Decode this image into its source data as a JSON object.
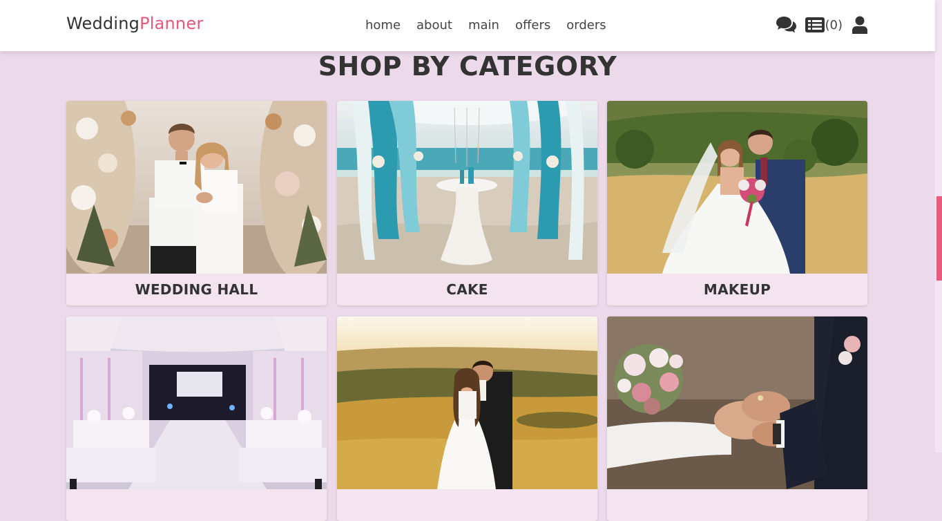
{
  "header": {
    "logo_main": "Wedding",
    "logo_accent": "Planner",
    "nav": [
      "home",
      "about",
      "main",
      "offers",
      "orders"
    ],
    "orders_count": "(0)"
  },
  "section_title": "SHOP BY CATEGORY",
  "categories": [
    {
      "label": "WEDDING HALL",
      "photo": "couple-with-flower-arch"
    },
    {
      "label": "CAKE",
      "photo": "beach-ceremony-canopy"
    },
    {
      "label": "MAKEUP",
      "photo": "couple-in-field"
    },
    {
      "label": "",
      "photo": "decorated-banquet-hall"
    },
    {
      "label": "",
      "photo": "couple-at-sunset"
    },
    {
      "label": "",
      "photo": "holding-hands-with-bouquet"
    }
  ],
  "colors": {
    "background": "#ecdaeb",
    "accent": "#e8577c",
    "card": "#f3e4f0"
  },
  "icons": [
    "comments-icon",
    "list-icon",
    "user-icon"
  ]
}
